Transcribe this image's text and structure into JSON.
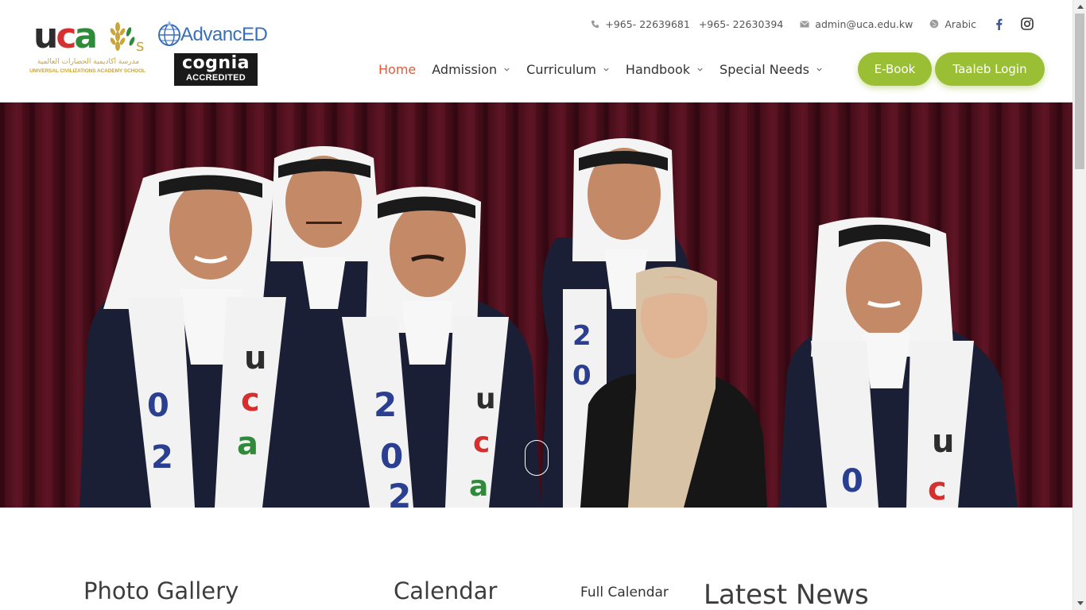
{
  "logos": {
    "uca": {
      "letters": [
        "u",
        "c",
        "a"
      ],
      "suffix": "s",
      "arabic_name": "مدرسة أكاديمية الحضارات العالمية",
      "english_name": "UNIVERSAL CIVILIZATIONS ACADEMY SCHOOL"
    },
    "advanced": {
      "text": "AdvancED"
    },
    "cognia": {
      "name": "cognia",
      "badge": "ACCREDITED"
    }
  },
  "topbar": {
    "phone_icon": "phone-icon",
    "phone1": "+965- 22639681",
    "phone2": "+965- 22630394",
    "email_icon": "mail-icon",
    "email": "admin@uca.edu.kw",
    "language_icon": "globe-icon",
    "language": "Arabic",
    "facebook_icon": "facebook-icon",
    "instagram_icon": "instagram-icon"
  },
  "nav": {
    "items": [
      {
        "label": "Home",
        "active": true,
        "has_dropdown": false
      },
      {
        "label": "Admission",
        "active": false,
        "has_dropdown": true
      },
      {
        "label": "Curriculum",
        "active": false,
        "has_dropdown": true
      },
      {
        "label": "Handbook",
        "active": false,
        "has_dropdown": true
      },
      {
        "label": "Special Needs",
        "active": false,
        "has_dropdown": true
      }
    ],
    "ebook_label": "E-Book",
    "taaleb_label": "Taaleb Login"
  },
  "hero": {
    "sash_text": [
      "2",
      "0",
      "2",
      "u",
      "c",
      "a"
    ]
  },
  "sections": {
    "gallery_title": "Photo Gallery",
    "calendar_title": "Calendar",
    "full_calendar_link": "Full Calendar",
    "news_title": "Latest News"
  },
  "colors": {
    "accent_green": "#9abf34",
    "active_nav": "#e05a3b",
    "uca_red": "#d62f2f",
    "uca_green": "#2f8a3a",
    "uca_gold": "#c9a53a",
    "advanced_blue": "#3a6fb8",
    "curtain": "#4a0f1c"
  }
}
